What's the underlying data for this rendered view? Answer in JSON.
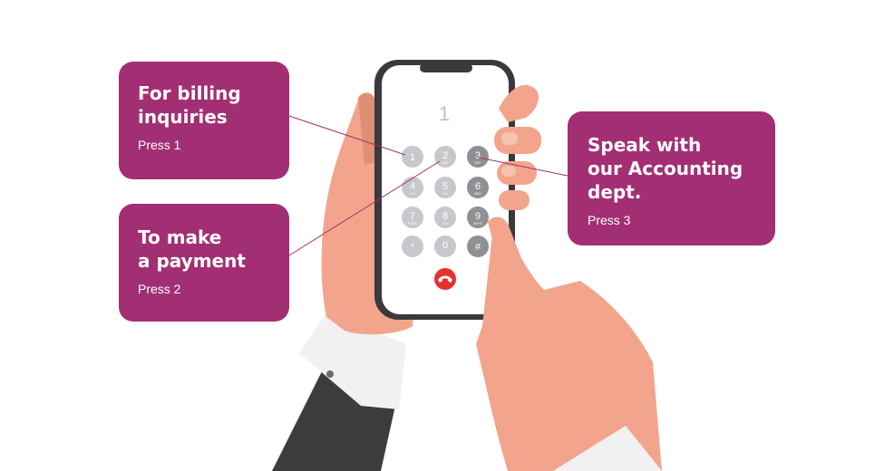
{
  "screen": {
    "display_digit": "1"
  },
  "keypad": {
    "keys": [
      {
        "digit": "1",
        "letters": ""
      },
      {
        "digit": "2",
        "letters": "ABC"
      },
      {
        "digit": "3",
        "letters": "DEF"
      },
      {
        "digit": "4",
        "letters": "GHI"
      },
      {
        "digit": "5",
        "letters": "JKL"
      },
      {
        "digit": "6",
        "letters": "MNO"
      },
      {
        "digit": "7",
        "letters": "PQRS"
      },
      {
        "digit": "8",
        "letters": "TUV"
      },
      {
        "digit": "9",
        "letters": "WXYZ"
      },
      {
        "digit": "*",
        "letters": ""
      },
      {
        "digit": "0",
        "letters": "+"
      },
      {
        "digit": "#",
        "letters": ""
      }
    ]
  },
  "callouts": {
    "billing": {
      "title": "For billing\ninquiries",
      "subtitle": "Press 1"
    },
    "payment": {
      "title": "To make\na payment",
      "subtitle": "Press 2"
    },
    "accounting": {
      "title": "Speak with\nour Accounting\ndept.",
      "subtitle": "Press 3"
    }
  },
  "colors": {
    "card": "#a22f73",
    "skin": "#f2a58c",
    "skin_shadow": "#e08f77",
    "sleeve": "#3c3c3c",
    "cuff": "#f1f1f1",
    "phone_frame": "#3a3a3c",
    "end_call": "#e8302d"
  },
  "icons": {
    "end_call": "phone-hangup-icon"
  }
}
